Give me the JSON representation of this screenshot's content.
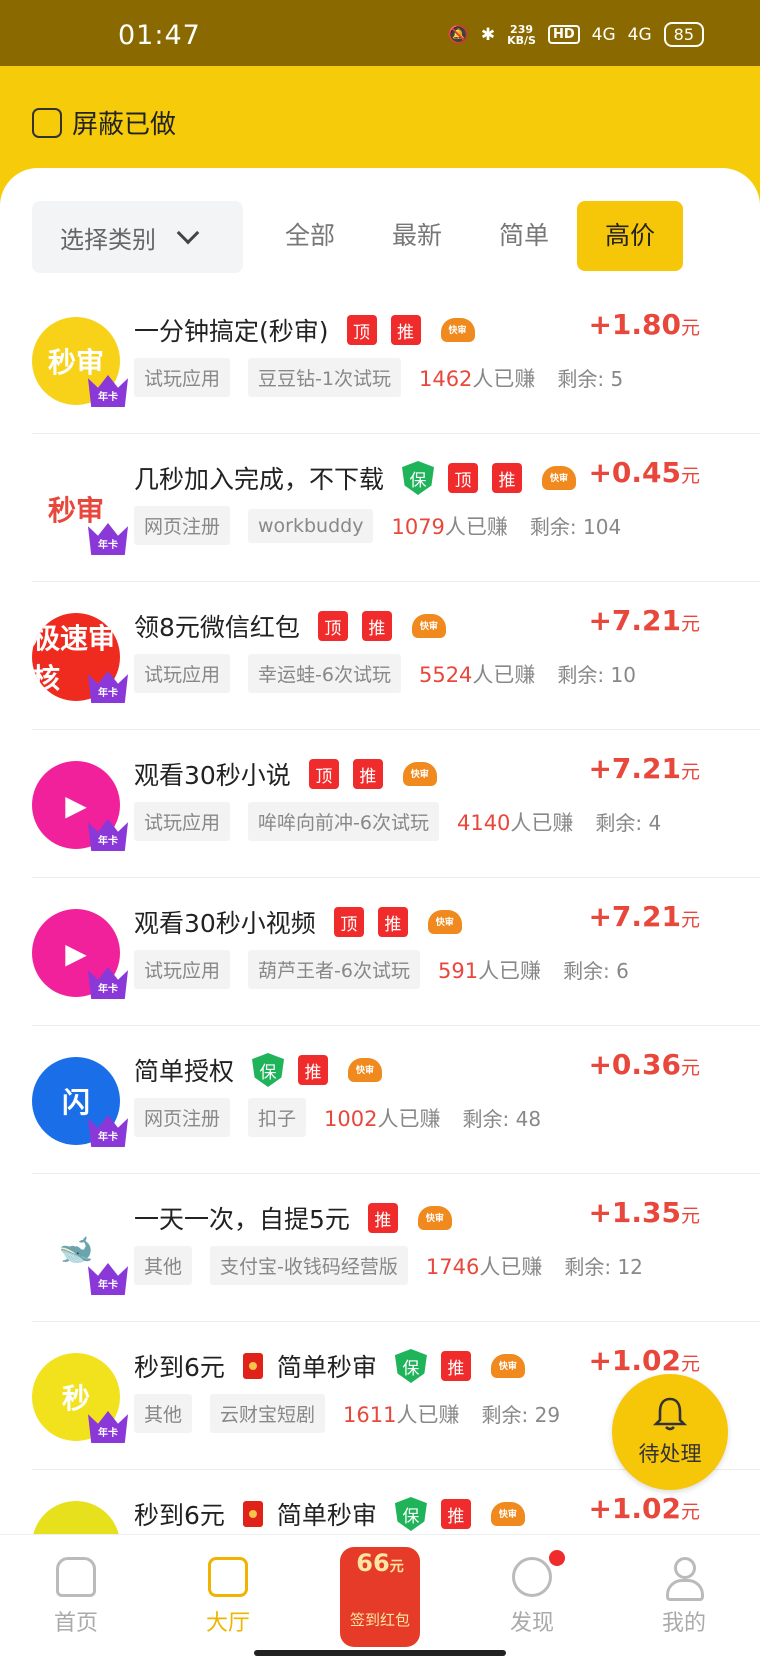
{
  "status_bar": {
    "time": "01:47",
    "speed_value": "239",
    "speed_unit": "KB/S",
    "hd": "HD",
    "signal_1": "4G",
    "signal_2": "4G",
    "battery": "85"
  },
  "filter": {
    "shield_done_label": "屏蔽已做"
  },
  "category_select": {
    "label": "选择类别"
  },
  "tabs": [
    {
      "label": "全部",
      "active": false
    },
    {
      "label": "最新",
      "active": false
    },
    {
      "label": "简单",
      "active": false
    },
    {
      "label": "高价",
      "active": true
    }
  ],
  "badge_labels": {
    "top": "顶",
    "recommend": "推",
    "guarantee": "保",
    "fast": "快审",
    "card": "年卡"
  },
  "earned_suffix": "人已赚",
  "remain_prefix": "剩余: ",
  "currency": "元",
  "tasks": [
    {
      "title": "一分钟搞定(秒审)",
      "tags": [
        "top",
        "recommend",
        "fast"
      ],
      "price": "+1.80",
      "category": "试玩应用",
      "source": "豆豆钻-1次试玩",
      "earned": "1462",
      "remaining": "5",
      "avatar_text": "秒审",
      "avatar_color": "#f7d219"
    },
    {
      "title": "几秒加入完成，不下载",
      "tags": [
        "guarantee",
        "top",
        "recommend",
        "fast"
      ],
      "price": "+0.45",
      "category": "网页注册",
      "source": "workbuddy",
      "earned": "1079",
      "remaining": "104",
      "avatar_text": "秒审",
      "avatar_color": "#ffffff"
    },
    {
      "title": "领8元微信红包",
      "tags": [
        "top",
        "recommend",
        "fast"
      ],
      "price": "+7.21",
      "category": "试玩应用",
      "source": "幸运蛙-6次试玩",
      "earned": "5524",
      "remaining": "10",
      "avatar_text": "极速审核",
      "avatar_color": "#ef2b1f"
    },
    {
      "title": "观看30秒小说",
      "tags": [
        "top",
        "recommend",
        "fast"
      ],
      "price": "+7.21",
      "category": "试玩应用",
      "source": "哞哞向前冲-6次试玩",
      "earned": "4140",
      "remaining": "4",
      "avatar_text": "▶",
      "avatar_color": "#f0219a"
    },
    {
      "title": "观看30秒小视频",
      "tags": [
        "top",
        "recommend",
        "fast"
      ],
      "price": "+7.21",
      "category": "试玩应用",
      "source": "葫芦王者-6次试玩",
      "earned": "591",
      "remaining": "6",
      "avatar_text": "▶",
      "avatar_color": "#f0219a"
    },
    {
      "title": "简单授权",
      "tags": [
        "guarantee",
        "recommend",
        "fast"
      ],
      "price": "+0.36",
      "category": "网页注册",
      "source": "扣子",
      "earned": "1002",
      "remaining": "48",
      "avatar_text": "闪",
      "avatar_color": "#1a6fe8"
    },
    {
      "title": "一天一次，自提5元",
      "tags": [
        "recommend",
        "fast"
      ],
      "price": "+1.35",
      "category": "其他",
      "source": "支付宝-收钱码经营版",
      "earned": "1746",
      "remaining": "12",
      "avatar_text": "🐋",
      "avatar_color": "#ffffff"
    },
    {
      "title": "秒到6元",
      "title_after_bag": "简单秒审",
      "tags": [
        "guarantee",
        "recommend",
        "fast"
      ],
      "price": "+1.02",
      "category": "其他",
      "source": "云财宝短剧",
      "earned": "1611",
      "remaining": "29",
      "avatar_text": "秒",
      "avatar_color": "#f2e21e"
    },
    {
      "title": "秒到6元",
      "title_after_bag": "简单秒审",
      "tags": [
        "guarantee",
        "recommend",
        "fast"
      ],
      "price": "+1.02",
      "category": "",
      "source": "",
      "earned": "",
      "remaining": "",
      "avatar_text": "",
      "avatar_color": "#e7e01d"
    }
  ],
  "fab": {
    "label": "待处理"
  },
  "bottom_nav": [
    {
      "label": "首页",
      "icon": "home-icon",
      "active": false
    },
    {
      "label": "大厅",
      "icon": "hall-icon",
      "active": true
    },
    {
      "label": "签到红包",
      "icon": "red-envelope-icon",
      "amount": "66",
      "amount_unit": "元"
    },
    {
      "label": "发现",
      "icon": "compass-icon",
      "active": false,
      "notification_dot": true
    },
    {
      "label": "我的",
      "icon": "user-icon",
      "active": false
    }
  ],
  "colors": {
    "brand_yellow": "#f6c609",
    "price_red": "#e8473c",
    "tag_red": "#f02b2b",
    "guarantee_green": "#1fb35a"
  }
}
